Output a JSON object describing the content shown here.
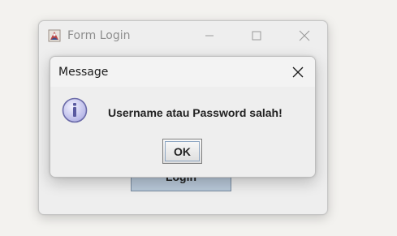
{
  "parent_window": {
    "title": "Form Login",
    "app_icon": "java-cup-icon",
    "controls": {
      "minimize": "minimize-icon",
      "maximize": "maximize-icon",
      "close": "close-icon"
    },
    "login_button_label": "Login"
  },
  "dialog": {
    "title": "Message",
    "close_icon": "close-icon",
    "icon": "info-icon",
    "message": "Username atau Password salah!",
    "ok_label": "OK"
  },
  "colors": {
    "background": "#f3f2ef",
    "window_body": "#eeeeee",
    "login_button_bg": "#b8c8d8",
    "info_icon_fill": "#c8c8f0",
    "info_icon_stroke": "#6a6aa8"
  }
}
